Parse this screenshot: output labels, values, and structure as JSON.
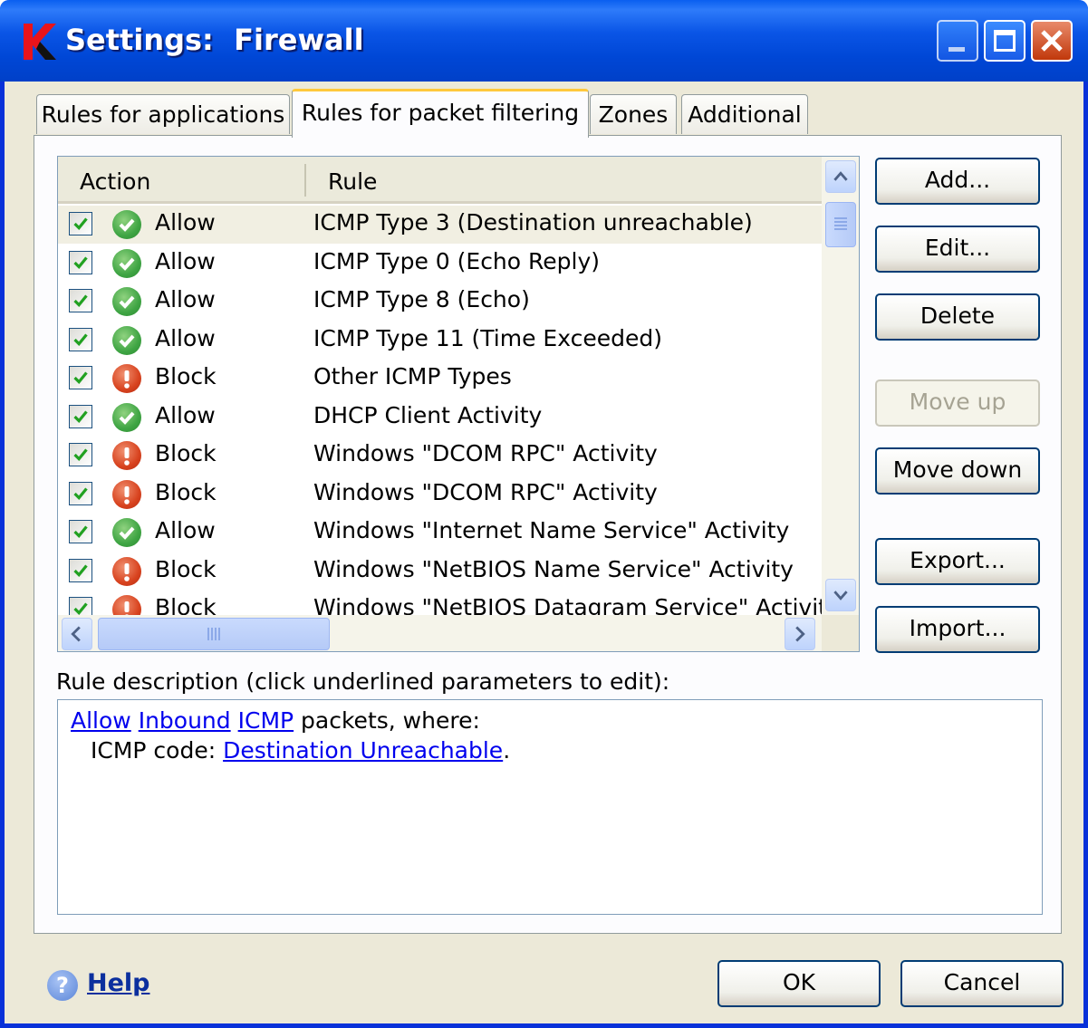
{
  "window": {
    "title": "Settings:  Firewall",
    "controls": [
      "minimize",
      "maximize",
      "close"
    ]
  },
  "tabs": [
    {
      "label": "Rules for applications",
      "active": false
    },
    {
      "label": "Rules for packet filtering",
      "active": true
    },
    {
      "label": "Zones",
      "active": false
    },
    {
      "label": "Additional",
      "active": false
    }
  ],
  "list": {
    "columns": [
      "Action",
      "Rule"
    ],
    "rows": [
      {
        "checked": true,
        "action": "Allow",
        "rule": "ICMP Type 3 (Destination unreachable)",
        "selected": true
      },
      {
        "checked": true,
        "action": "Allow",
        "rule": "ICMP Type 0 (Echo Reply)"
      },
      {
        "checked": true,
        "action": "Allow",
        "rule": "ICMP Type 8 (Echo)"
      },
      {
        "checked": true,
        "action": "Allow",
        "rule": "ICMP Type 11 (Time Exceeded)"
      },
      {
        "checked": true,
        "action": "Block",
        "rule": "Other ICMP Types"
      },
      {
        "checked": true,
        "action": "Allow",
        "rule": "DHCP Client Activity"
      },
      {
        "checked": true,
        "action": "Block",
        "rule": "Windows \"DCOM RPC\" Activity"
      },
      {
        "checked": true,
        "action": "Block",
        "rule": "Windows \"DCOM RPC\" Activity"
      },
      {
        "checked": true,
        "action": "Allow",
        "rule": "Windows \"Internet Name Service\" Activity"
      },
      {
        "checked": true,
        "action": "Block",
        "rule": "Windows \"NetBIOS Name Service\" Activity"
      },
      {
        "checked": true,
        "action": "Block",
        "rule": "Windows \"NetBIOS Datagram Service\" Activity"
      }
    ]
  },
  "side_buttons": {
    "add": "Add...",
    "edit": "Edit...",
    "delete": "Delete",
    "move_up": "Move up",
    "move_down": "Move down",
    "export": "Export...",
    "import": "Import..."
  },
  "description": {
    "label": "Rule description (click underlined parameters to edit):",
    "action_link": "Allow",
    "direction_link": "Inbound",
    "protocol_link": "ICMP",
    "line1_suffix": " packets, where:",
    "code_prefix": "ICMP code: ",
    "code_link": "Destination Unreachable",
    "code_suffix": "."
  },
  "footer": {
    "help_icon_glyph": "?",
    "help": "Help",
    "ok": "OK",
    "cancel": "Cancel"
  },
  "colors": {
    "allow": "#3FA544",
    "block": "#D8431F",
    "link": "#0000EE",
    "titlebar": "#0A55E6"
  }
}
